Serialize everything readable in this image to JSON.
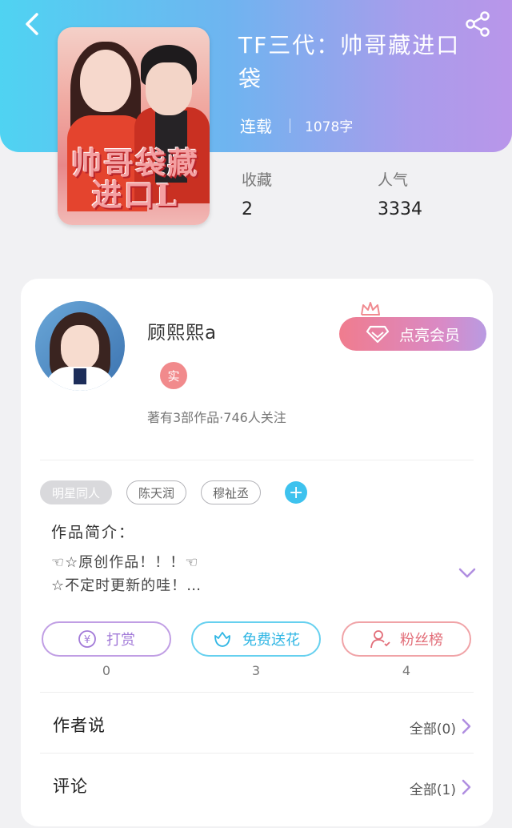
{
  "header": {
    "title": "TF三代：帅哥藏进口袋",
    "status": "连载",
    "word_count": "1078字",
    "stats": [
      {
        "label": "收藏",
        "value": "2"
      },
      {
        "label": "人气",
        "value": "3334"
      }
    ],
    "cover_text": "帅哥袋藏进口L",
    "colors": {
      "gradient_start": "#4fd3f2",
      "gradient_end": "#b996ea"
    }
  },
  "author": {
    "name": "顾熙熙a",
    "verified_badge": "实",
    "meta": "著有3部作品·746人关注",
    "vip_button": "点亮会员"
  },
  "tags": {
    "items": [
      "明星同人",
      "陈天润",
      "穆祉丞"
    ],
    "add_label": "+"
  },
  "intro": {
    "title": "作品简介：",
    "line1": "☜☆原创作品！！！☜",
    "line2": "☆不定时更新的哇！…"
  },
  "actions": [
    {
      "label": "打赏",
      "count": "0",
      "icon": "yuan-coin-icon"
    },
    {
      "label": "免费送花",
      "count": "3",
      "icon": "flower-icon"
    },
    {
      "label": "粉丝榜",
      "count": "4",
      "icon": "fans-user-icon"
    }
  ],
  "sections": [
    {
      "title": "作者说",
      "all_label": "全部(0)"
    },
    {
      "title": "评论",
      "all_label": "全部(1)"
    }
  ]
}
